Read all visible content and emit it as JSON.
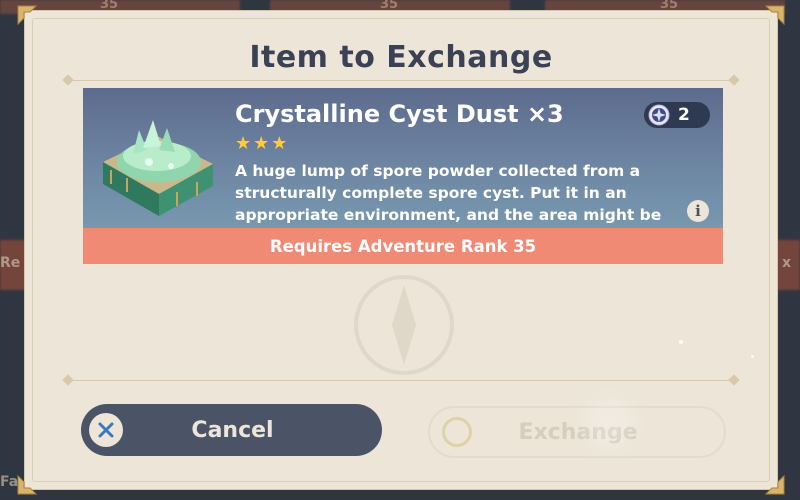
{
  "dialog": {
    "title": "Item to Exchange"
  },
  "item": {
    "name": "Crystalline Cyst Dust ×3",
    "rarity_stars": 3,
    "description": "A huge lump of spore powder collected from a structurally complete spore cyst. Put it in an appropriate environment, and the area might be filled with sticky spores (...)",
    "icon": "crystalline-cyst-dust-icon",
    "owned_count": "2",
    "count_icon": "intertwined-fate-icon",
    "requirement": "Requires Adventure Rank 35"
  },
  "buttons": {
    "cancel_label": "Cancel",
    "cancel_icon": "close-icon",
    "exchange_label": "Exchange",
    "exchange_icon": "confirm-circle-icon",
    "exchange_enabled": false
  },
  "background": {
    "tile_numbers": [
      "35",
      "35",
      "35"
    ],
    "side_left_text": "Re",
    "side_right_text": "x",
    "bottom_left_text": "Fa"
  },
  "colors": {
    "dialog_bg": "#ece5d8",
    "title_text": "#3b4255",
    "card_gradient_top": "#5d6b8c",
    "card_gradient_bottom": "#7da3b6",
    "requirement_bg": "#f08a75",
    "star": "#ffcc32",
    "cancel_bg": "#4b5366"
  }
}
